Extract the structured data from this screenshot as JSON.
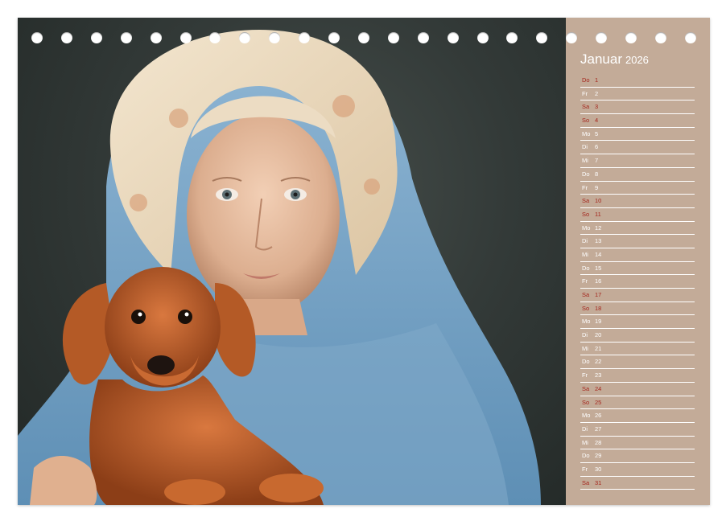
{
  "calendar": {
    "month": "Januar",
    "year": "2026",
    "days": [
      {
        "weekday": "Do",
        "day": "1",
        "weekend": true
      },
      {
        "weekday": "Fr",
        "day": "2",
        "weekend": false
      },
      {
        "weekday": "Sa",
        "day": "3",
        "weekend": true
      },
      {
        "weekday": "So",
        "day": "4",
        "weekend": true
      },
      {
        "weekday": "Mo",
        "day": "5",
        "weekend": false
      },
      {
        "weekday": "Di",
        "day": "6",
        "weekend": false
      },
      {
        "weekday": "Mi",
        "day": "7",
        "weekend": false
      },
      {
        "weekday": "Do",
        "day": "8",
        "weekend": false
      },
      {
        "weekday": "Fr",
        "day": "9",
        "weekend": false
      },
      {
        "weekday": "Sa",
        "day": "10",
        "weekend": true
      },
      {
        "weekday": "So",
        "day": "11",
        "weekend": true
      },
      {
        "weekday": "Mo",
        "day": "12",
        "weekend": false
      },
      {
        "weekday": "Di",
        "day": "13",
        "weekend": false
      },
      {
        "weekday": "Mi",
        "day": "14",
        "weekend": false
      },
      {
        "weekday": "Do",
        "day": "15",
        "weekend": false
      },
      {
        "weekday": "Fr",
        "day": "16",
        "weekend": false
      },
      {
        "weekday": "Sa",
        "day": "17",
        "weekend": true
      },
      {
        "weekday": "So",
        "day": "18",
        "weekend": true
      },
      {
        "weekday": "Mo",
        "day": "19",
        "weekend": false
      },
      {
        "weekday": "Di",
        "day": "20",
        "weekend": false
      },
      {
        "weekday": "Mi",
        "day": "21",
        "weekend": false
      },
      {
        "weekday": "Do",
        "day": "22",
        "weekend": false
      },
      {
        "weekday": "Fr",
        "day": "23",
        "weekend": false
      },
      {
        "weekday": "Sa",
        "day": "24",
        "weekend": true
      },
      {
        "weekday": "So",
        "day": "25",
        "weekend": true
      },
      {
        "weekday": "Mo",
        "day": "26",
        "weekend": false
      },
      {
        "weekday": "Di",
        "day": "27",
        "weekend": false
      },
      {
        "weekday": "Mi",
        "day": "28",
        "weekend": false
      },
      {
        "weekday": "Do",
        "day": "29",
        "weekend": false
      },
      {
        "weekday": "Fr",
        "day": "30",
        "weekend": false
      },
      {
        "weekday": "Sa",
        "day": "31",
        "weekend": true
      }
    ]
  },
  "colors": {
    "sidebar": "#c3ab98",
    "weekend_text": "#a5261d",
    "weekday_text": "#ffffff"
  },
  "binding_holes": 23
}
